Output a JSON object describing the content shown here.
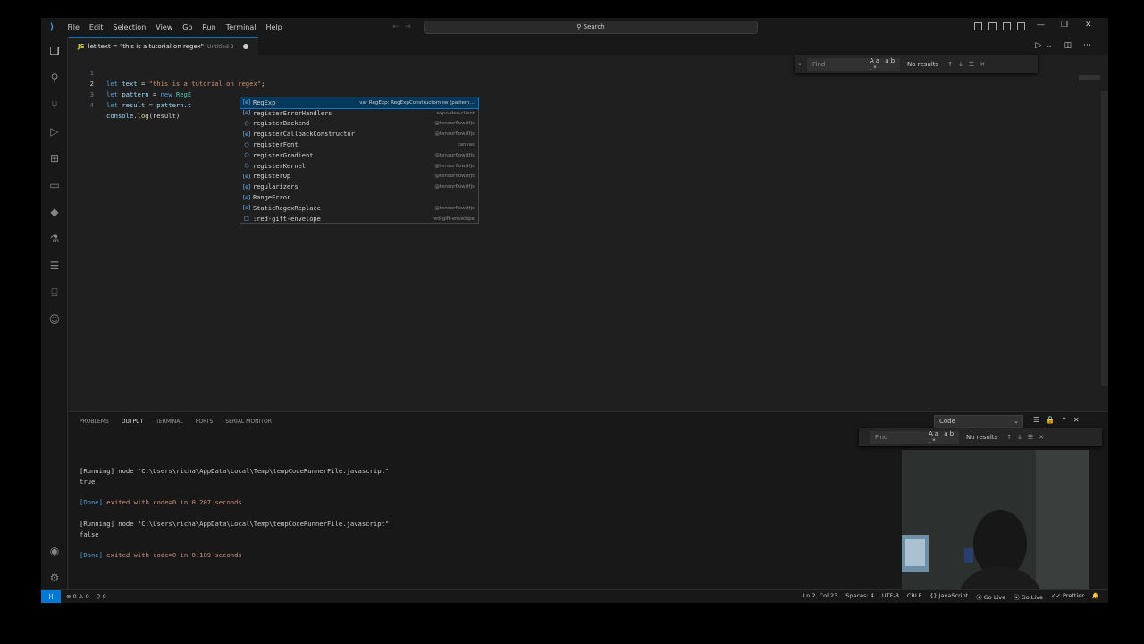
{
  "menu": [
    "File",
    "Edit",
    "Selection",
    "View",
    "Go",
    "Run",
    "Terminal",
    "Help"
  ],
  "search_label": "Search",
  "tab": {
    "icon": "JS",
    "name": "let text = \"this is a tutorial on regex\"",
    "sub": "Untitled-2"
  },
  "code": {
    "line_numbers": [
      "1",
      "2",
      "3",
      "4"
    ],
    "l1": {
      "kw": "let",
      "var": "text",
      "eq": " = ",
      "str": "\"this is a tutorial on regex\"",
      "end": ";"
    },
    "l2": {
      "kw": "let",
      "var": "pattern",
      "eq": " = ",
      "kw2": "new",
      "cls": "RegE"
    },
    "l3": {
      "kw": "let",
      "var": "result",
      "eq": " = ",
      "obj": "pattern.t"
    },
    "l4": {
      "obj": "console",
      "dot": ".",
      "fn": "log",
      "args": "(result)"
    }
  },
  "editor_find": {
    "placeholder": "Find",
    "options": "Aa ab .*",
    "status": "No results"
  },
  "suggestions": [
    {
      "icon": "[e]",
      "label": "RegExp",
      "match": "R",
      "detail": "var RegExp: RegExpConstructornew (pattern…",
      "selected": true
    },
    {
      "icon": "[e]",
      "label": "registerErrorHandlers",
      "detail": "expo-dev-client"
    },
    {
      "icon": "⬡",
      "label": "registerBackend",
      "detail": "@tensorflow/tfjs"
    },
    {
      "icon": "[e]",
      "label": "registerCallbackConstructor",
      "detail": "@tensorflow/tfjs"
    },
    {
      "icon": "⬡",
      "label": "registerFont",
      "detail": "canvas"
    },
    {
      "icon": "⬡",
      "label": "registerGradient",
      "detail": "@tensorflow/tfjs"
    },
    {
      "icon": "⬡",
      "label": "registerKernel",
      "detail": "@tensorflow/tfjs"
    },
    {
      "icon": "[e]",
      "label": "registerOp",
      "detail": "@tensorflow/tfjs"
    },
    {
      "icon": "[e]",
      "label": "regularizers",
      "detail": "@tensorflow/tfjs"
    },
    {
      "icon": "[e]",
      "label": "RangeError",
      "detail": ""
    },
    {
      "icon": "[e]",
      "label": "StaticRegexReplace",
      "detail": "@tensorflow/tfjs"
    },
    {
      "icon": "□",
      "label": ":red-gift-envelope",
      "detail": "red-gift-envelope"
    }
  ],
  "panel": {
    "tabs": [
      "PROBLEMS",
      "OUTPUT",
      "TERMINAL",
      "PORTS",
      "SERIAL MONITOR"
    ],
    "active_tab": "OUTPUT",
    "channel": "Code",
    "find_placeholder": "Find",
    "find_options": "Aa ab .*",
    "find_status": "No results",
    "output": [
      {
        "type": "text",
        "text": "[Running] node \"C:\\Users\\richa\\AppData\\Local\\Temp\\tempCodeRunnerFile.javascript\""
      },
      {
        "type": "text",
        "text": "true"
      },
      {
        "type": "blank",
        "text": ""
      },
      {
        "type": "done",
        "tag": "[Done]",
        "text": " exited with code=0 in 0.207 seconds"
      },
      {
        "type": "blank",
        "text": ""
      },
      {
        "type": "text",
        "text": "[Running] node \"C:\\Users\\richa\\AppData\\Local\\Temp\\tempCodeRunnerFile.javascript\""
      },
      {
        "type": "text",
        "text": "false"
      },
      {
        "type": "blank",
        "text": ""
      },
      {
        "type": "done",
        "tag": "[Done]",
        "text": " exited with code=0 in 0.189 seconds"
      }
    ]
  },
  "status": {
    "errors": "⊗ 0 ⚠ 0",
    "ports": "⚲ 0",
    "position": "Ln 2, Col 23",
    "spaces": "Spaces: 4",
    "encoding": "UTF-8",
    "eol": "CRLF",
    "language": "{} JavaScript",
    "golive1": "⦿ Go Live",
    "golive2": "⦿ Go Live",
    "prettier": "✓✓ Prettier"
  }
}
